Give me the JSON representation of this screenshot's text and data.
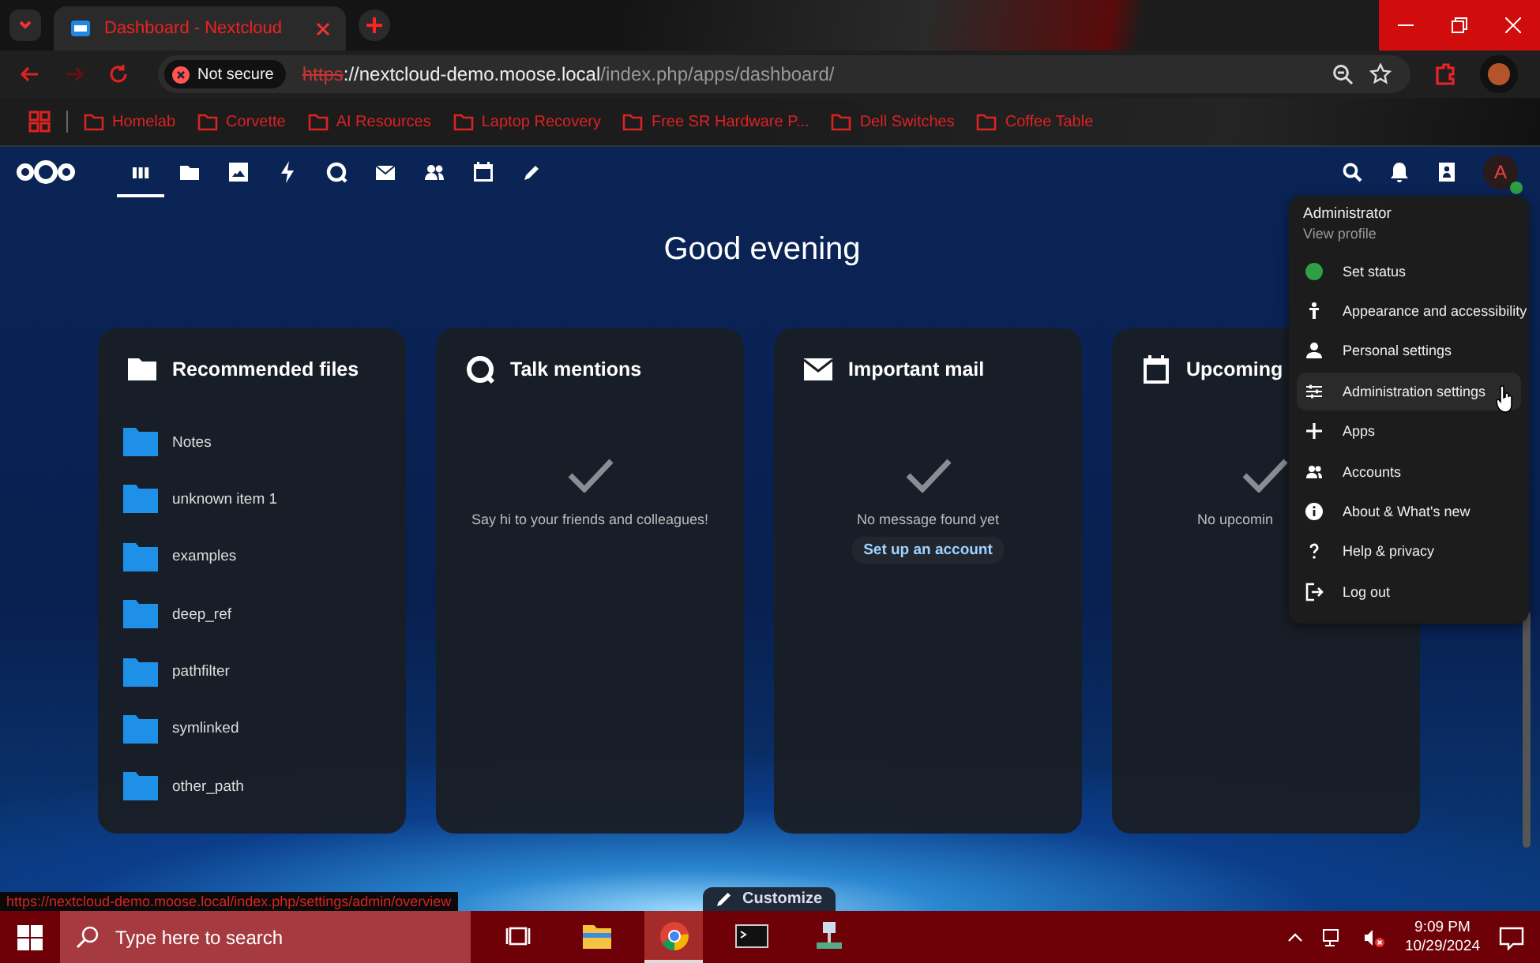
{
  "browser": {
    "tabs": [
      {
        "title": "Dashboard - Nextcloud",
        "selected": true
      }
    ],
    "address": {
      "security": "Not secure",
      "scheme": "https",
      "host": "://nextcloud-demo.moose.local",
      "path": "/index.php/apps/dashboard/"
    },
    "bookmarks": [
      "Homelab",
      "Corvette",
      "AI Resources",
      "Laptop Recovery",
      "Free SR Hardware P...",
      "Dell Switches",
      "Coffee Table"
    ],
    "status_url": "https://nextcloud-demo.moose.local/index.php/settings/admin/overview"
  },
  "header": {
    "apps": [
      {
        "kind": "dashboard",
        "selected": true
      },
      {
        "kind": "files",
        "selected": false
      },
      {
        "kind": "photos",
        "selected": false
      },
      {
        "kind": "activity",
        "selected": false
      },
      {
        "kind": "talk",
        "selected": false
      },
      {
        "kind": "mail",
        "selected": false
      },
      {
        "kind": "contacts",
        "selected": false
      },
      {
        "kind": "calendar",
        "selected": false
      },
      {
        "kind": "notes",
        "selected": false
      }
    ],
    "avatar_letter": "A"
  },
  "greeting": "Good evening",
  "widgets": [
    {
      "kind": "files",
      "title": "Recommended files",
      "items": [
        "Notes",
        "unknown item 1",
        "examples",
        "deep_ref",
        "pathfilter",
        "symlinked",
        "other_path"
      ]
    },
    {
      "kind": "talk",
      "title": "Talk mentions",
      "message": "Say hi to your friends and colleagues!"
    },
    {
      "kind": "mail",
      "title": "Important mail",
      "message": "No message found yet",
      "button": "Set up an account"
    },
    {
      "kind": "calendar",
      "title": "Upcoming",
      "message": "No upcomin"
    }
  ],
  "customize": "Customize",
  "user_menu": {
    "name": "Administrator",
    "profile": "View profile",
    "items": [
      {
        "kind": "status",
        "label": "Set status",
        "highlighted": false
      },
      {
        "kind": "appearance",
        "label": "Appearance and accessibility",
        "highlighted": false
      },
      {
        "kind": "person",
        "label": "Personal settings",
        "highlighted": false
      },
      {
        "kind": "admin",
        "label": "Administration settings",
        "highlighted": true
      },
      {
        "kind": "plus",
        "label": "Apps",
        "highlighted": false
      },
      {
        "kind": "accounts",
        "label": "Accounts",
        "highlighted": false
      },
      {
        "kind": "info",
        "label": "About & What's new",
        "highlighted": false
      },
      {
        "kind": "help",
        "label": "Help & privacy",
        "highlighted": false
      },
      {
        "kind": "logout",
        "label": "Log out",
        "highlighted": false
      }
    ]
  },
  "taskbar": {
    "search_placeholder": "Type here to search",
    "apps": [
      {
        "kind": "taskview",
        "selected": false
      },
      {
        "kind": "explorer",
        "selected": false
      },
      {
        "kind": "chrome",
        "selected": true
      },
      {
        "kind": "terminal",
        "selected": false
      },
      {
        "kind": "network",
        "selected": false
      }
    ],
    "time": "9:09 PM",
    "date": "10/29/2024"
  }
}
